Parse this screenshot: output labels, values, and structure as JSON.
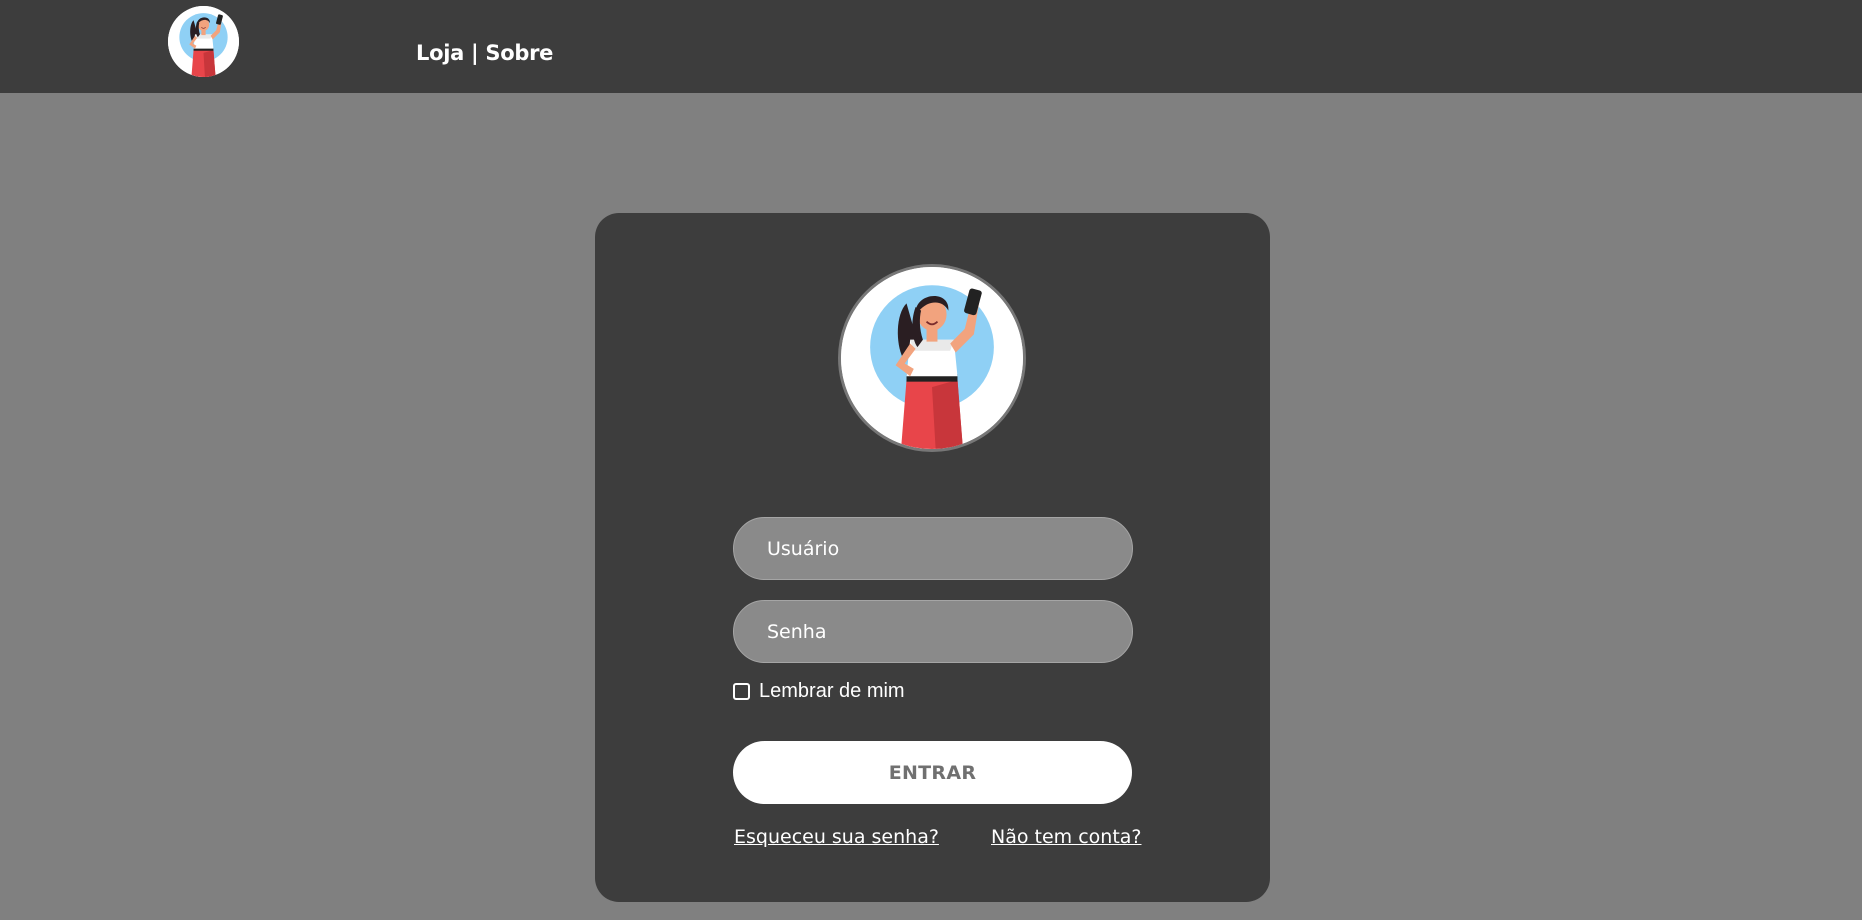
{
  "header": {
    "logo_icon": "woman-selfie-avatar-icon",
    "nav_store": "Loja",
    "nav_separator": " | ",
    "nav_about": "Sobre"
  },
  "login": {
    "avatar_icon": "woman-selfie-avatar-icon",
    "username_placeholder": "Usuário",
    "password_placeholder": "Senha",
    "remember_label": "Lembrar de mim",
    "remember_checked": false,
    "submit_label": "ENTRAR",
    "forgot_link": "Esqueceu sua senha?",
    "signup_link": "Não tem conta?"
  },
  "colors": {
    "page_background": "#808080",
    "panel_background": "#3d3d3d",
    "input_background": "#8a8a8a",
    "button_background": "#ffffff",
    "button_text": "#707070",
    "avatar_sky": "#8fd0f5",
    "avatar_pants": "#e8454a"
  }
}
